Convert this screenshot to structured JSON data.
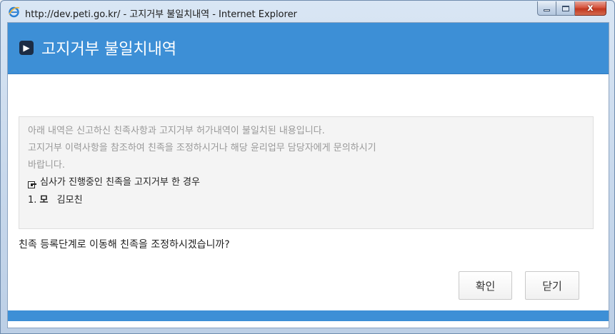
{
  "window": {
    "title": "http://dev.peti.go.kr/ - 고지거부 불일치내역 - Internet Explorer",
    "close_glyph": "x"
  },
  "dialog": {
    "title": "고지거부 불일치내역",
    "notice_lines": [
      "아래 내역은 신고하신 친족사항과 고지거부 허가내역이 불일치된 내용입니다.",
      "고지거부 이력사항을 참조하여 친족을 조정하시거나 해당 윤리업무 담당자에게 문의하시기",
      "바랍니다."
    ],
    "case_label": "심사가 진행중인 친족을 고지거부 한 경우",
    "relatives": [
      {
        "index": "1.",
        "relation": "모",
        "name": "김모친"
      }
    ],
    "question": "친족 등록단계로 이동해 친족을 조정하시겠습니까?",
    "confirm_label": "확인",
    "close_label": "닫기"
  },
  "colors": {
    "header": "#3d8fd6",
    "notice_bg": "#f4f4f4",
    "notice_text": "#999999"
  },
  "icons": [
    "internet-explorer-icon",
    "arrow-right-icon",
    "pointing-hand-icon"
  ]
}
